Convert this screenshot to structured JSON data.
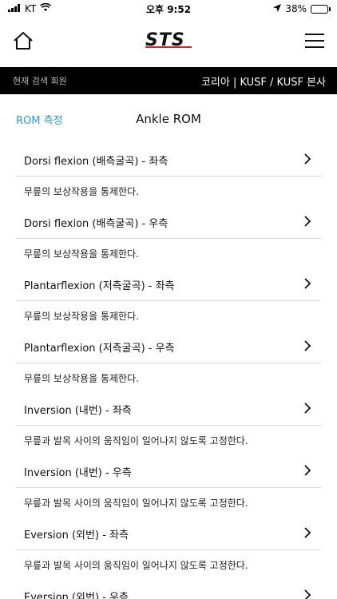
{
  "status": {
    "carrier": "KT",
    "time": "오후 9:52",
    "battery": "38%",
    "battery_level": 0.38
  },
  "header": {
    "logo_text": "STS"
  },
  "member_bar": {
    "label": "현재 검색 회원",
    "location": "코리아  |  KUSF / KUSF 본사"
  },
  "nav": {
    "back_label": "ROM 측정",
    "title": "Ankle ROM"
  },
  "items": [
    {
      "title": "Dorsi flexion (배측굴곡) - 좌측",
      "desc": "무릎의 보상작용을 통제한다."
    },
    {
      "title": "Dorsi flexion (배측굴곡) - 우측",
      "desc": "무릎의 보상작용을 통제한다."
    },
    {
      "title": "Plantarflexion (저측굴곡) - 좌측",
      "desc": "무릎의 보상작용을 통제한다."
    },
    {
      "title": "Plantarflexion (저측굴곡) - 우측",
      "desc": "무릎의 보상작용을 통제한다."
    },
    {
      "title": "Inversion (내번) - 좌측",
      "desc": "무릎과 발목 사이의 움직임이 일어나지 않도록 고정한다."
    },
    {
      "title": "Inversion (내번) - 우측",
      "desc": "무릎과 발목 사이의 움직임이 일어나지 않도록 고정한다."
    },
    {
      "title": "Eversion (외번) - 좌측",
      "desc": "무릎과 발목 사이의 움직임이 일어나지 않도록 고정한다."
    },
    {
      "title": "Eversion (외번) - 우측",
      "desc": ""
    }
  ],
  "colors": {
    "accent": "#2a9bd8",
    "bar": "#000000",
    "logo_accent": "#e02020",
    "battery": "#f4c20d"
  }
}
